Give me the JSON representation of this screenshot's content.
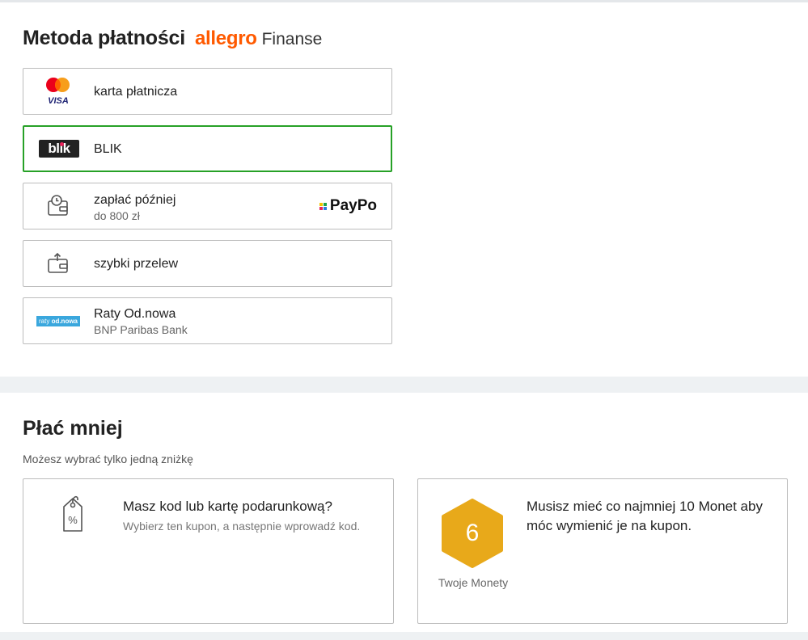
{
  "payment": {
    "title": "Metoda płatności",
    "brand_allegro": "allegro",
    "brand_finanse": "Finanse",
    "methods": [
      {
        "label": "karta płatnicza",
        "icon": "mastercard-visa-icon"
      },
      {
        "label": "BLIK",
        "icon": "blik-logo",
        "selected": true
      },
      {
        "label": "zapłać później",
        "sublabel": "do 800 zł",
        "icon": "wallet-clock-icon",
        "partner": "PayPo"
      },
      {
        "label": "szybki przelew",
        "icon": "wallet-transfer-icon"
      },
      {
        "label": "Raty Od.nowa",
        "sublabel": "BNP Paribas Bank",
        "icon": "raty-odnowa-logo"
      }
    ],
    "raty_logo_a": "raty",
    "raty_logo_b": "od.nowa",
    "blik_logo": "blik",
    "visa_text": "VISA"
  },
  "discount": {
    "title": "Płać mniej",
    "hint": "Możesz wybrać tylko jedną zniżkę",
    "coupon": {
      "title": "Masz kod lub kartę podarunkową?",
      "subtitle": "Wybierz ten kupon, a następnie wprowadź kod."
    },
    "coins": {
      "count": "6",
      "label": "Twoje Monety",
      "message": "Musisz mieć co najmniej 10 Monet aby móc wymienić je na kupon."
    }
  },
  "colors": {
    "accent": "#ff5a00",
    "selected_border": "#27a127",
    "coin": "#e8a91a",
    "raty": "#3aa7dd"
  }
}
